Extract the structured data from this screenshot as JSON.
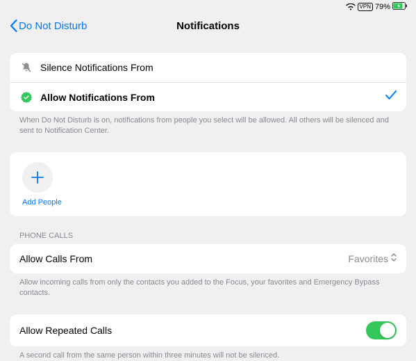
{
  "status": {
    "vpn": "VPN",
    "battery_pct": "79%"
  },
  "header": {
    "back_label": "Do Not Disturb",
    "title": "Notifications"
  },
  "notif_modes": {
    "silence": "Silence Notifications From",
    "allow": "Allow Notifications From",
    "footer": "When Do Not Disturb is on, notifications from people you select will be allowed. All others will be silenced and sent to Notification Center."
  },
  "add": {
    "label": "Add People"
  },
  "phone_section": {
    "header": "Phone Calls",
    "allow_calls_label": "Allow Calls From",
    "allow_calls_value": "Favorites",
    "allow_calls_footer": "Allow incoming calls from only the contacts you added to the Focus, your favorites and Emergency Bypass contacts.",
    "repeated_label": "Allow Repeated Calls",
    "repeated_footer": "A second call from the same person within three minutes will not be silenced."
  }
}
